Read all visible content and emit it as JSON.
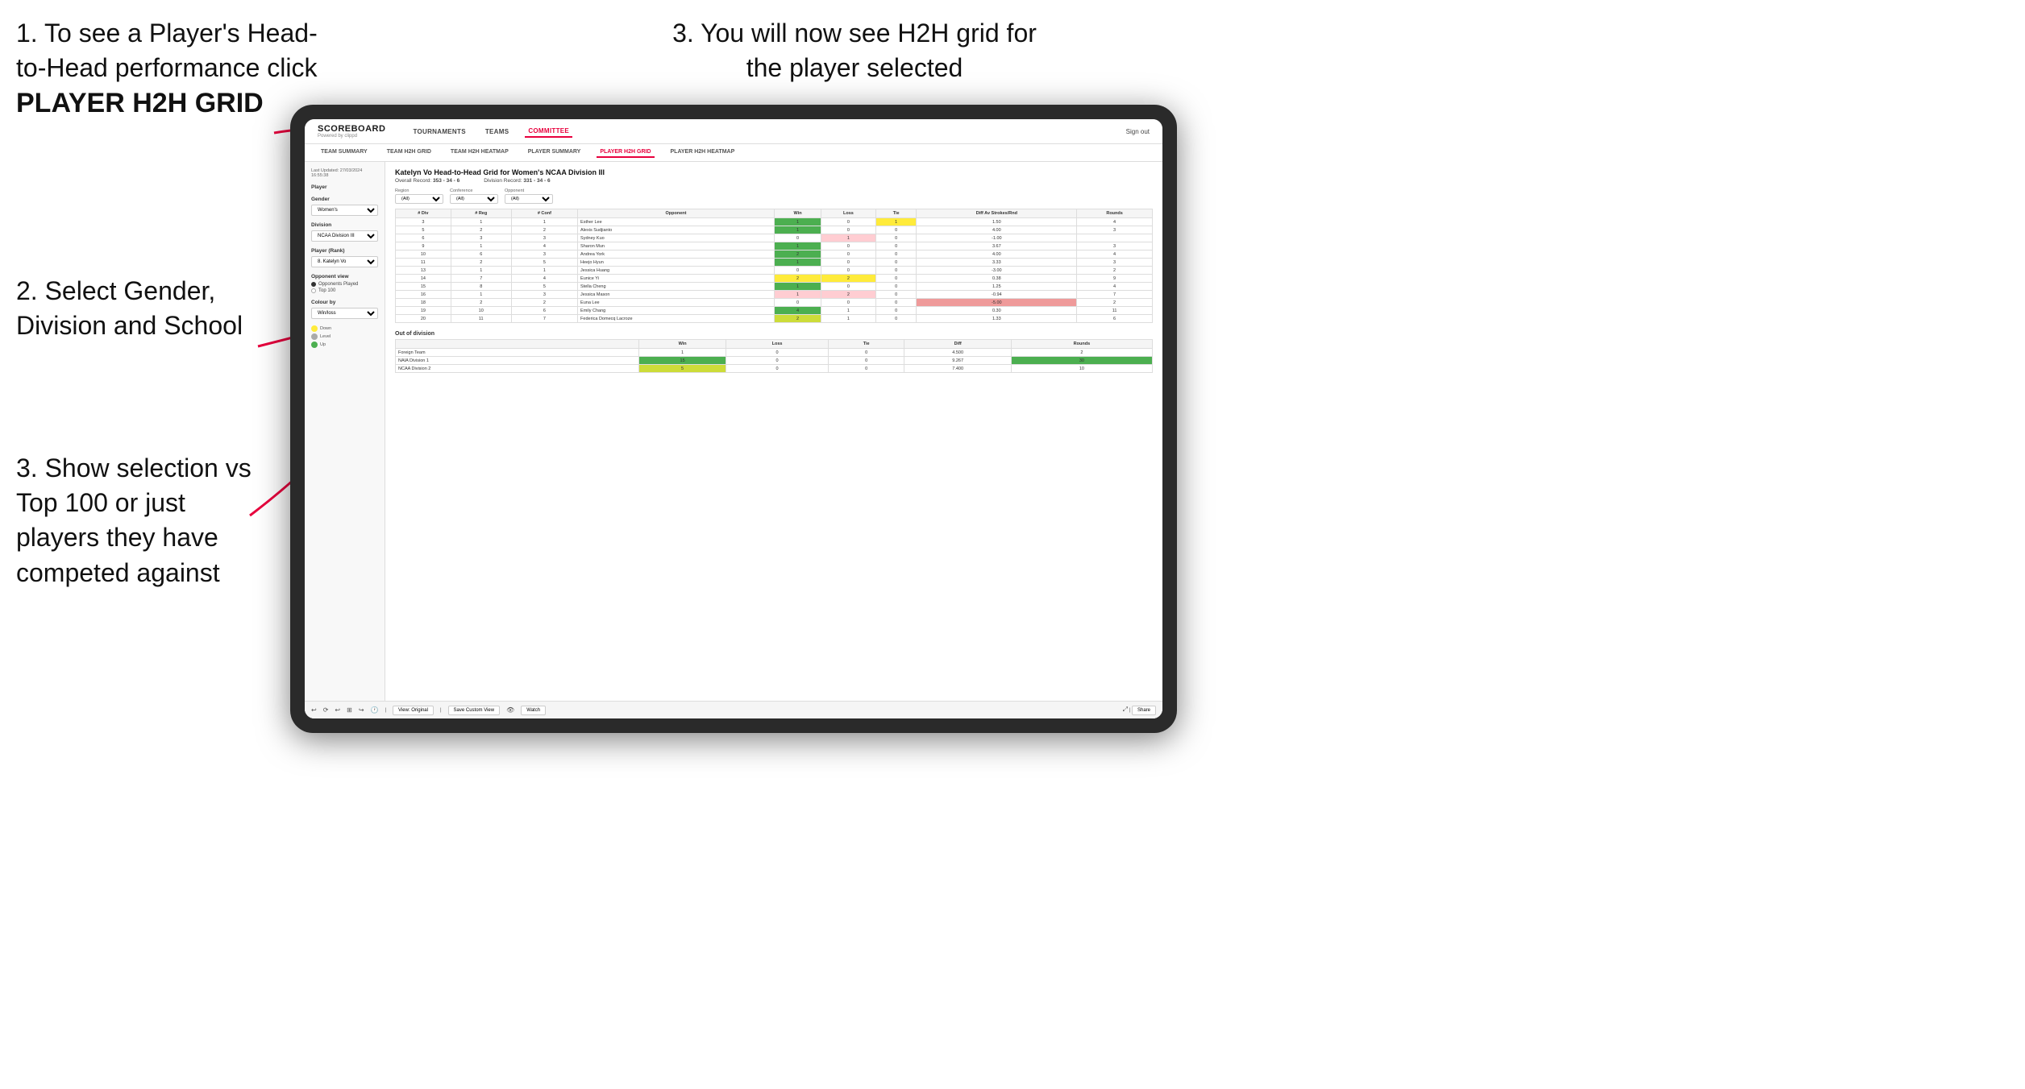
{
  "instructions": {
    "step1_title": "1. To see a Player's Head-to-Head performance click",
    "step1_bold": "PLAYER H2H GRID",
    "step2_title": "2. Select Gender, Division and School",
    "step3a_title": "3. You will now see H2H grid for the player selected",
    "step3b_title": "3. Show selection vs Top 100 or just players they have competed against",
    "note_numbers": {
      "top_left": "3.",
      "top_right": "3."
    }
  },
  "nav": {
    "logo": "SCOREBOARD",
    "logo_sub": "Powered by clippd",
    "items": [
      "TOURNAMENTS",
      "TEAMS",
      "COMMITTEE"
    ],
    "active_item": "COMMITTEE",
    "sign_out": "Sign out"
  },
  "sub_nav": {
    "items": [
      "TEAM SUMMARY",
      "TEAM H2H GRID",
      "TEAM H2H HEATMAP",
      "PLAYER SUMMARY",
      "PLAYER H2H GRID",
      "PLAYER H2H HEATMAP"
    ],
    "active": "PLAYER H2H GRID"
  },
  "left_panel": {
    "last_updated_label": "Last Updated: 27/03/2024",
    "last_updated_time": "16:55:38",
    "player_label": "Player",
    "gender_label": "Gender",
    "gender_value": "Women's",
    "division_label": "Division",
    "division_value": "NCAA Division III",
    "player_rank_label": "Player (Rank)",
    "player_rank_value": "8. Katelyn Vo",
    "opponent_view_label": "Opponent view",
    "opponent_options": [
      "Opponents Played",
      "Top 100"
    ],
    "selected_opponent": "Opponents Played",
    "colour_by_label": "Colour by",
    "colour_by_value": "Win/loss",
    "legend": [
      {
        "label": "Down",
        "color": "#ffeb3b"
      },
      {
        "label": "Level",
        "color": "#aaaaaa"
      },
      {
        "label": "Up",
        "color": "#4caf50"
      }
    ]
  },
  "grid": {
    "title": "Katelyn Vo Head-to-Head Grid for Women's NCAA Division III",
    "overall_record_label": "Overall Record:",
    "overall_record": "353 - 34 - 6",
    "division_record_label": "Division Record:",
    "division_record": "331 - 34 - 6",
    "filter_region_label": "Region",
    "filter_conference_label": "Conference",
    "filter_opponent_label": "Opponent",
    "opponents_label": "Opponents:",
    "filter_all": "(All)",
    "columns": [
      "# Div",
      "# Reg",
      "# Conf",
      "Opponent",
      "Win",
      "Loss",
      "Tie",
      "Diff Av Strokes/Rnd",
      "Rounds"
    ],
    "rows": [
      {
        "div": "3",
        "reg": "1",
        "conf": "1",
        "opponent": "Esther Lee",
        "win": 1,
        "loss": 0,
        "tie": 1,
        "diff": "1.50",
        "rounds": 4,
        "win_color": "green",
        "loss_color": "",
        "tie_color": "yellow"
      },
      {
        "div": "5",
        "reg": "2",
        "conf": "2",
        "opponent": "Alexis Sudjianto",
        "win": 1,
        "loss": 0,
        "tie": 0,
        "diff": "4.00",
        "rounds": 3,
        "win_color": "green"
      },
      {
        "div": "6",
        "reg": "3",
        "conf": "3",
        "opponent": "Sydney Kuo",
        "win": 0,
        "loss": 1,
        "tie": 0,
        "diff": "-1.00",
        "rounds": "",
        "win_color": ""
      },
      {
        "div": "9",
        "reg": "1",
        "conf": "4",
        "opponent": "Sharon Mun",
        "win": 1,
        "loss": 0,
        "tie": 0,
        "diff": "3.67",
        "rounds": 3,
        "win_color": "green"
      },
      {
        "div": "10",
        "reg": "6",
        "conf": "3",
        "opponent": "Andrea York",
        "win": 2,
        "loss": 0,
        "tie": 0,
        "diff": "4.00",
        "rounds": 4,
        "win_color": "green"
      },
      {
        "div": "11",
        "reg": "2",
        "conf": "5",
        "opponent": "Heejo Hyun",
        "win": 1,
        "loss": 0,
        "tie": 0,
        "diff": "3.33",
        "rounds": 3,
        "win_color": "green"
      },
      {
        "div": "13",
        "reg": "1",
        "conf": "1",
        "opponent": "Jessica Huang",
        "win": 0,
        "loss": 0,
        "tie": 0,
        "diff": "-3.00",
        "rounds": 2,
        "win_color": ""
      },
      {
        "div": "14",
        "reg": "7",
        "conf": "4",
        "opponent": "Eunice Yi",
        "win": 2,
        "loss": 2,
        "tie": 0,
        "diff": "0.38",
        "rounds": 9,
        "win_color": "yellow"
      },
      {
        "div": "15",
        "reg": "8",
        "conf": "5",
        "opponent": "Stella Cheng",
        "win": 1,
        "loss": 0,
        "tie": 0,
        "diff": "1.25",
        "rounds": 4,
        "win_color": "green"
      },
      {
        "div": "16",
        "reg": "1",
        "conf": "3",
        "opponent": "Jessica Mason",
        "win": 1,
        "loss": 2,
        "tie": 0,
        "diff": "-0.94",
        "rounds": 7,
        "win_color": "red"
      },
      {
        "div": "18",
        "reg": "2",
        "conf": "2",
        "opponent": "Euna Lee",
        "win": 0,
        "loss": 0,
        "tie": 0,
        "diff": "-5.00",
        "rounds": 2,
        "win_color": "red"
      },
      {
        "div": "19",
        "reg": "10",
        "conf": "6",
        "opponent": "Emily Chang",
        "win": 4,
        "loss": 1,
        "tie": 0,
        "diff": "0.30",
        "rounds": 11,
        "win_color": "green"
      },
      {
        "div": "20",
        "reg": "11",
        "conf": "7",
        "opponent": "Federica Domecq Lacroze",
        "win": 2,
        "loss": 1,
        "tie": 0,
        "diff": "1.33",
        "rounds": 6,
        "win_color": "green"
      }
    ],
    "out_division_label": "Out of division",
    "out_division_rows": [
      {
        "team": "Foreign Team",
        "win": 1,
        "loss": 0,
        "tie": 0,
        "diff": "4.500",
        "rounds": 2,
        "color": ""
      },
      {
        "team": "NAIA Division 1",
        "win": 15,
        "loss": 0,
        "tie": 0,
        "diff": "9.267",
        "rounds": 30,
        "color": "green"
      },
      {
        "team": "NCAA Division 2",
        "win": 5,
        "loss": 0,
        "tie": 0,
        "diff": "7.400",
        "rounds": 10,
        "color": "green"
      }
    ]
  },
  "toolbar": {
    "buttons": [
      "View: Original",
      "Save Custom View",
      "Watch",
      "Share"
    ],
    "icons": [
      "undo",
      "redo",
      "undo2",
      "crop",
      "redo2",
      "clock"
    ]
  }
}
